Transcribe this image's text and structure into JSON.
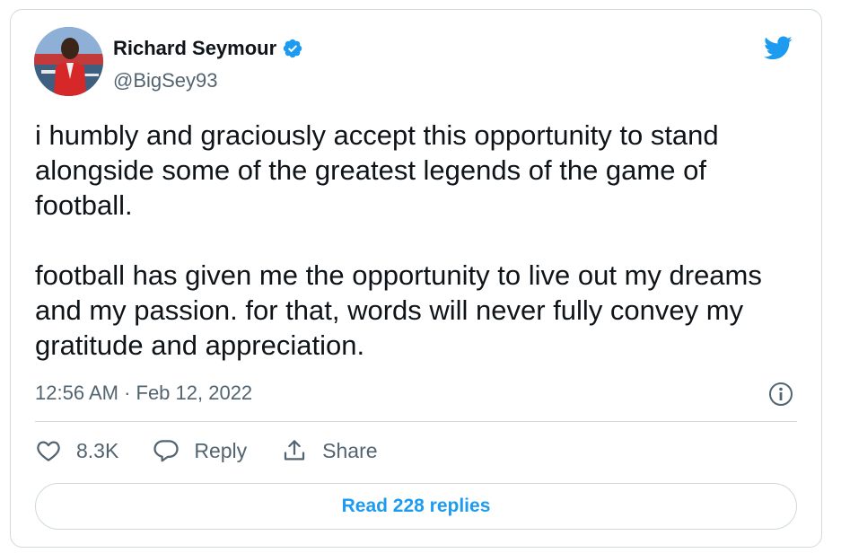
{
  "tweet": {
    "author_name": "Richard Seymour",
    "author_handle": "@BigSey93",
    "text": "i humbly and graciously accept this opportunity to stand alongside some of the greatest legends of the game of football.\n\nfootball has given me the opportunity to live out my dreams and my passion. for that, words will never fully convey my gratitude and appreciation.",
    "timestamp": "12:56 AM · Feb 12, 2022"
  },
  "actions": {
    "like_count": "8.3K",
    "reply_label": "Reply",
    "share_label": "Share"
  },
  "read_replies_label": "Read 228 replies",
  "icons": {
    "verified": "verified-badge-icon",
    "brand": "twitter-bird-icon",
    "info": "info-icon",
    "like": "heart-icon",
    "reply": "speech-bubble-icon",
    "share": "share-icon"
  },
  "colors": {
    "accent": "#1d9bf0",
    "text": "#0f1419",
    "secondary": "#536471",
    "border": "#cfd9de"
  }
}
